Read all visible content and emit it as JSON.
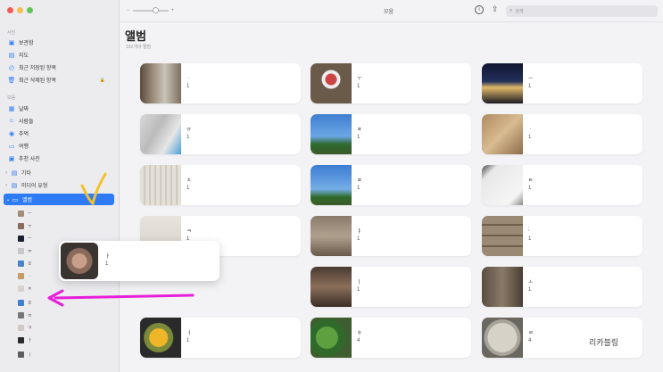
{
  "window": {
    "title": "모음"
  },
  "toolbar": {
    "zoom_minus": "−",
    "zoom_plus": "+",
    "title": "모음",
    "info_label": "i",
    "share_label": "⇪",
    "search_placeholder": "검색"
  },
  "sidebar": {
    "section_photos": "사진",
    "section_collections": "모음",
    "items": [
      {
        "label": "보관함",
        "icon": "library-icon"
      },
      {
        "label": "지도",
        "icon": "map-icon"
      },
      {
        "label": "최근 저장된 항목",
        "icon": "recent-icon"
      },
      {
        "label": "최근 삭제된 항목",
        "icon": "trash-icon",
        "locked": true
      },
      {
        "label": "날짜",
        "icon": "calendar-icon"
      },
      {
        "label": "사람들",
        "icon": "people-icon"
      },
      {
        "label": "추억",
        "icon": "memories-icon"
      },
      {
        "label": "여행",
        "icon": "trip-icon"
      },
      {
        "label": "추천 사진",
        "icon": "featured-icon"
      },
      {
        "label": "기타",
        "icon": "other-icon"
      },
      {
        "label": "미디어 유형",
        "icon": "media-icon"
      },
      {
        "label": "앨범",
        "icon": "album-icon"
      }
    ],
    "lock_label": "🔒",
    "sub_albums": [
      "ㅡ",
      "ㅜ",
      "ㅡ",
      "ㅠ",
      "ㅍ",
      "ㆍ",
      "ㅊ",
      "ㅍ",
      "ㅂ",
      "ㅋ",
      "ㅏ",
      "ㅣ"
    ]
  },
  "main": {
    "title": "앨범",
    "subtitle": "152개의 앨범",
    "albums": [
      {
        "name": "ㆍ",
        "count": "1"
      },
      {
        "name": "ㅜ",
        "count": "1"
      },
      {
        "name": "ㅡ",
        "count": "1"
      },
      {
        "name": "ㅠ",
        "count": "1"
      },
      {
        "name": "ㅍ",
        "count": "1"
      },
      {
        "name": "ㆍ",
        "count": "1"
      },
      {
        "name": "ㅊ",
        "count": "1"
      },
      {
        "name": "ㅍ",
        "count": "1"
      },
      {
        "name": "ㅌ",
        "count": "1"
      },
      {
        "name": "ㅋ",
        "count": "1"
      },
      {
        "name": "ㅑ",
        "count": "1"
      },
      {
        "name": ";",
        "count": "1"
      },
      {
        "name": "ㅣ",
        "count": "1"
      },
      {
        "name": "ㅗ",
        "count": "1"
      },
      {
        "name": "ㅓ",
        "count": "1"
      },
      {
        "name": "ㅎ",
        "count": "4"
      },
      {
        "name": "ㄹ",
        "count": "4"
      }
    ],
    "dragged": {
      "name": "ㅏ",
      "count": "1"
    }
  },
  "watermark": "리카블링",
  "colors": {
    "accent": "#2d7cf6",
    "annotation_arrow": "#e81ed9",
    "annotation_check": "#f2c12e"
  }
}
